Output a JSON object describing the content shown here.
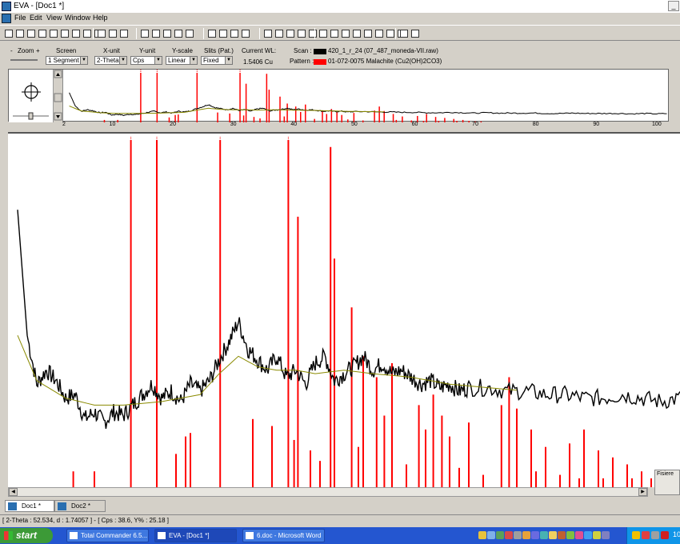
{
  "window": {
    "title": "EVA - [Doc1 *]"
  },
  "menu": [
    "File",
    "Edit",
    "View",
    "Window",
    "Help"
  ],
  "options": {
    "zoom_label": "Zoom",
    "zoom_minus": "-",
    "zoom_plus": "+",
    "screen_label": "Screen",
    "screen_value": "1 Segment",
    "xunit_label": "X-unit",
    "xunit_value": "2-Theta",
    "yunit_label": "Y-unit",
    "yunit_value": "Cps",
    "yscale_label": "Y-scale",
    "yscale_value": "Linear",
    "slits_label": "Slits (Pat.)",
    "slits_value": "Fixed",
    "wl_label": "Current WL:",
    "wl_value": "1.5406 Cu",
    "scan_label": "Scan :",
    "scan_value": "420_1_r_24 (07_487_moneda-VII.raw)",
    "pattern_label": "Pattern :",
    "pattern_value": "01-072-0075 Malachite (Cu2(OH)2CO3)",
    "scan_color": "#000000",
    "pattern_color": "#ff0000"
  },
  "overview_axis": {
    "ticks": [
      "2",
      "10",
      "20",
      "30",
      "40",
      "50",
      "60",
      "70",
      "80",
      "90",
      "100"
    ]
  },
  "chart_data": {
    "type": "line",
    "xlim": [
      2,
      102
    ],
    "ylim": [
      0,
      100
    ],
    "series": [
      {
        "name": "420_1_r_24 (07_487_moneda-VII.raw)",
        "color": "#000000",
        "x": [
          3,
          4,
          5,
          6,
          7,
          8,
          9,
          10,
          11,
          12,
          13,
          14,
          15,
          16,
          17,
          18,
          19,
          20,
          21,
          22,
          23,
          24,
          25,
          26,
          27,
          28,
          29,
          30,
          31,
          32,
          33,
          34,
          35,
          36,
          37,
          38,
          39,
          40,
          41,
          42,
          43,
          44,
          45,
          46,
          47,
          48,
          49,
          50,
          52,
          54,
          56,
          58,
          60,
          62,
          64,
          66,
          68,
          70,
          72,
          74,
          76,
          78,
          80,
          82,
          84,
          86,
          88,
          90,
          92,
          94,
          96,
          98,
          100,
          102
        ],
        "y": [
          80,
          44,
          30,
          34,
          31,
          26,
          27,
          20,
          22,
          19,
          22,
          21,
          24,
          27,
          30,
          26,
          28,
          25,
          30,
          28,
          31,
          37,
          42,
          48,
          40,
          37,
          34,
          38,
          32,
          34,
          30,
          36,
          38,
          31,
          33,
          35,
          38,
          34,
          36,
          33,
          34,
          32,
          30,
          31,
          29,
          30,
          28,
          29,
          29,
          28,
          28,
          27,
          27,
          26,
          26,
          27,
          26,
          25,
          26,
          25,
          25,
          25,
          25,
          24,
          24,
          25,
          24,
          24,
          24,
          24,
          23,
          24,
          23,
          24
        ]
      },
      {
        "name": "background",
        "color": "#8a8a00",
        "x": [
          3,
          5,
          8,
          11,
          14,
          18,
          22,
          24,
          26,
          28,
          30,
          32,
          34,
          37,
          40,
          44,
          48,
          52,
          56
        ],
        "y": [
          44,
          31,
          26,
          24,
          24,
          25,
          27,
          33,
          38,
          35,
          34,
          34,
          33,
          34,
          33,
          32,
          30,
          29,
          28
        ]
      }
    ],
    "sticks": {
      "name": "01-072-0075 Malachite (Cu2(OH)2CO3)",
      "color": "#ff0000",
      "x": [
        14.8,
        17.5,
        24.1,
        31.2,
        32.2,
        35.6,
        36.0,
        37.8,
        39.0,
        40.4,
        41.2,
        42.0,
        44.8,
        45.5,
        46.3,
        47.2,
        48.0,
        50.0,
        53.4,
        54.2,
        55.0,
        56.5,
        58.0,
        60.5,
        62.0,
        63.5,
        65.0,
        66.5,
        68.0,
        8.8,
        11.0,
        19.5,
        20.5,
        21.0,
        27.5,
        29.5,
        31.8,
        33.5,
        34.5,
        38.5,
        43.5,
        49.0,
        51.5,
        57.0,
        59.5,
        61.5,
        64.0,
        67.0,
        69.0,
        70.0,
        71.0
      ],
      "y": [
        100,
        100,
        100,
        100,
        78,
        98,
        66,
        52,
        38,
        32,
        21,
        36,
        24,
        17,
        27,
        21,
        15,
        19,
        24,
        32,
        23,
        17,
        12,
        13,
        17,
        11,
        9,
        7,
        5,
        5,
        5,
        10,
        15,
        16,
        20,
        18,
        14,
        11,
        8,
        12,
        7,
        6,
        4,
        5,
        4,
        3,
        3,
        3,
        3,
        2,
        2
      ]
    }
  },
  "tabs": [
    "Doc1 *",
    "Doc2 *"
  ],
  "side_panel": {
    "label": "Fisiere"
  },
  "status": {
    "text": "[ 2-Theta : 52.534, d : 1.74057 ] - [ Cps : 38.6, Y% : 25.18 ]"
  },
  "taskbar": {
    "start": "start",
    "tasks": [
      "Total Commander 6.5...",
      "EVA - [Doc1 *]",
      "6.doc - Microsoft Word"
    ],
    "clock": "10"
  }
}
